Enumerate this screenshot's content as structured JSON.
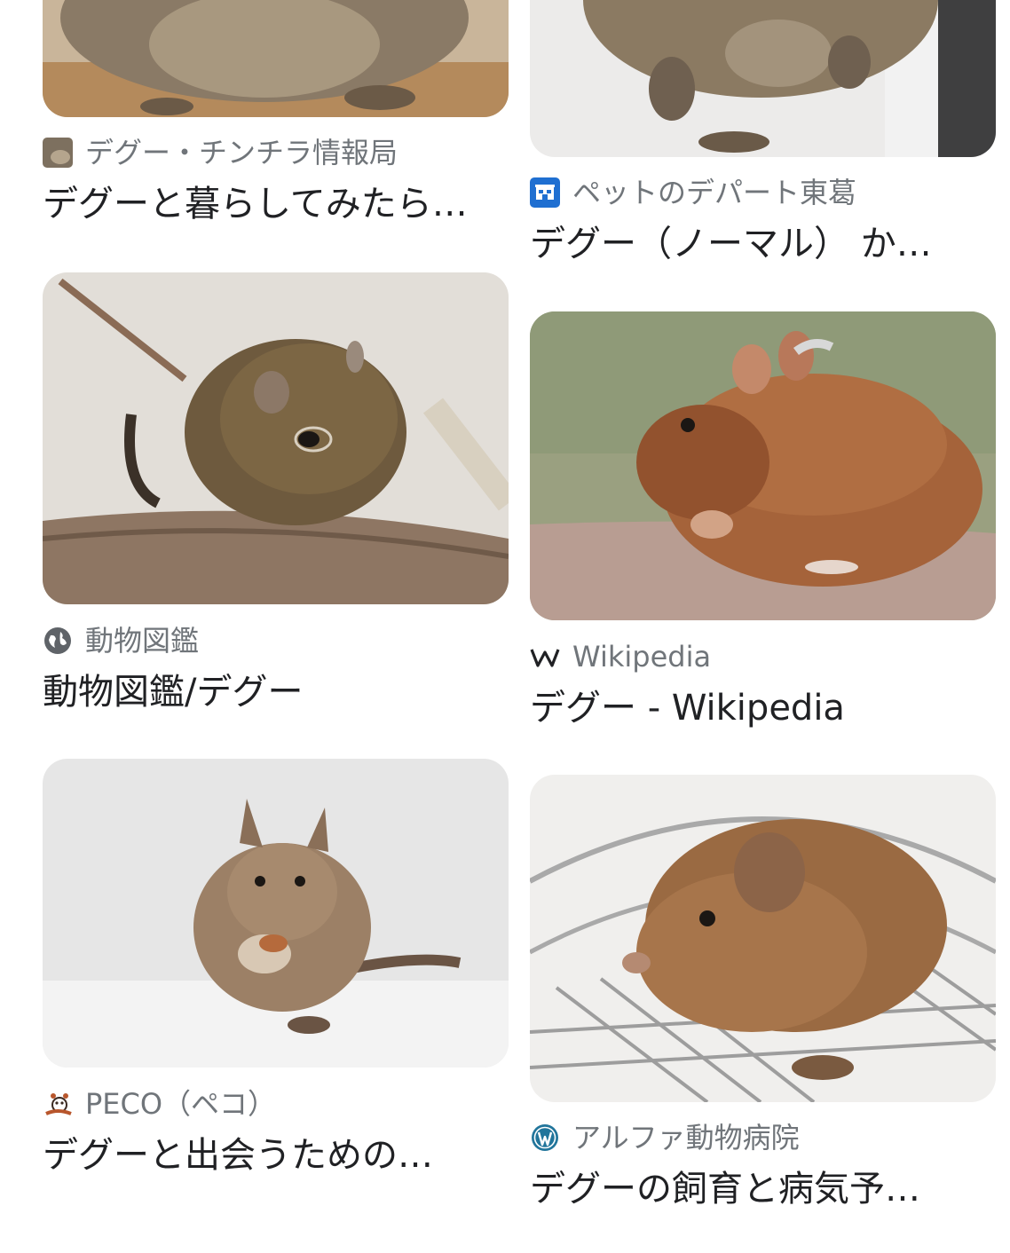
{
  "results": [
    {
      "source": "デグー・チンチラ情報局",
      "title": "デグーと暮らしてみたら…",
      "image": "degu-on-floor-photo",
      "favicon": "degu-photo-favicon"
    },
    {
      "source": "ペットのデパート東葛",
      "title": "デグー（ノーマル） か…",
      "image": "degu-front-view-photo",
      "favicon": "store-favicon"
    },
    {
      "source": "動物図鑑",
      "title": "動物図鑑/デグー",
      "image": "degu-on-branch-photo",
      "favicon": "globe-icon"
    },
    {
      "source": "Wikipedia",
      "title": "デグー - Wikipedia",
      "image": "degu-eating-photo",
      "favicon": "wikipedia-w-icon"
    },
    {
      "source": "PECO（ペコ）",
      "title": "デグーと出会うための…",
      "image": "degu-white-background-photo",
      "favicon": "peco-favicon"
    },
    {
      "source": "アルファ動物病院",
      "title": "デグーの飼育と病気予…",
      "image": "degu-on-wheel-photo",
      "favicon": "wordpress-icon"
    }
  ],
  "colors": {
    "source_text": "#70757a",
    "title_text": "#202124",
    "background": "#ffffff"
  }
}
